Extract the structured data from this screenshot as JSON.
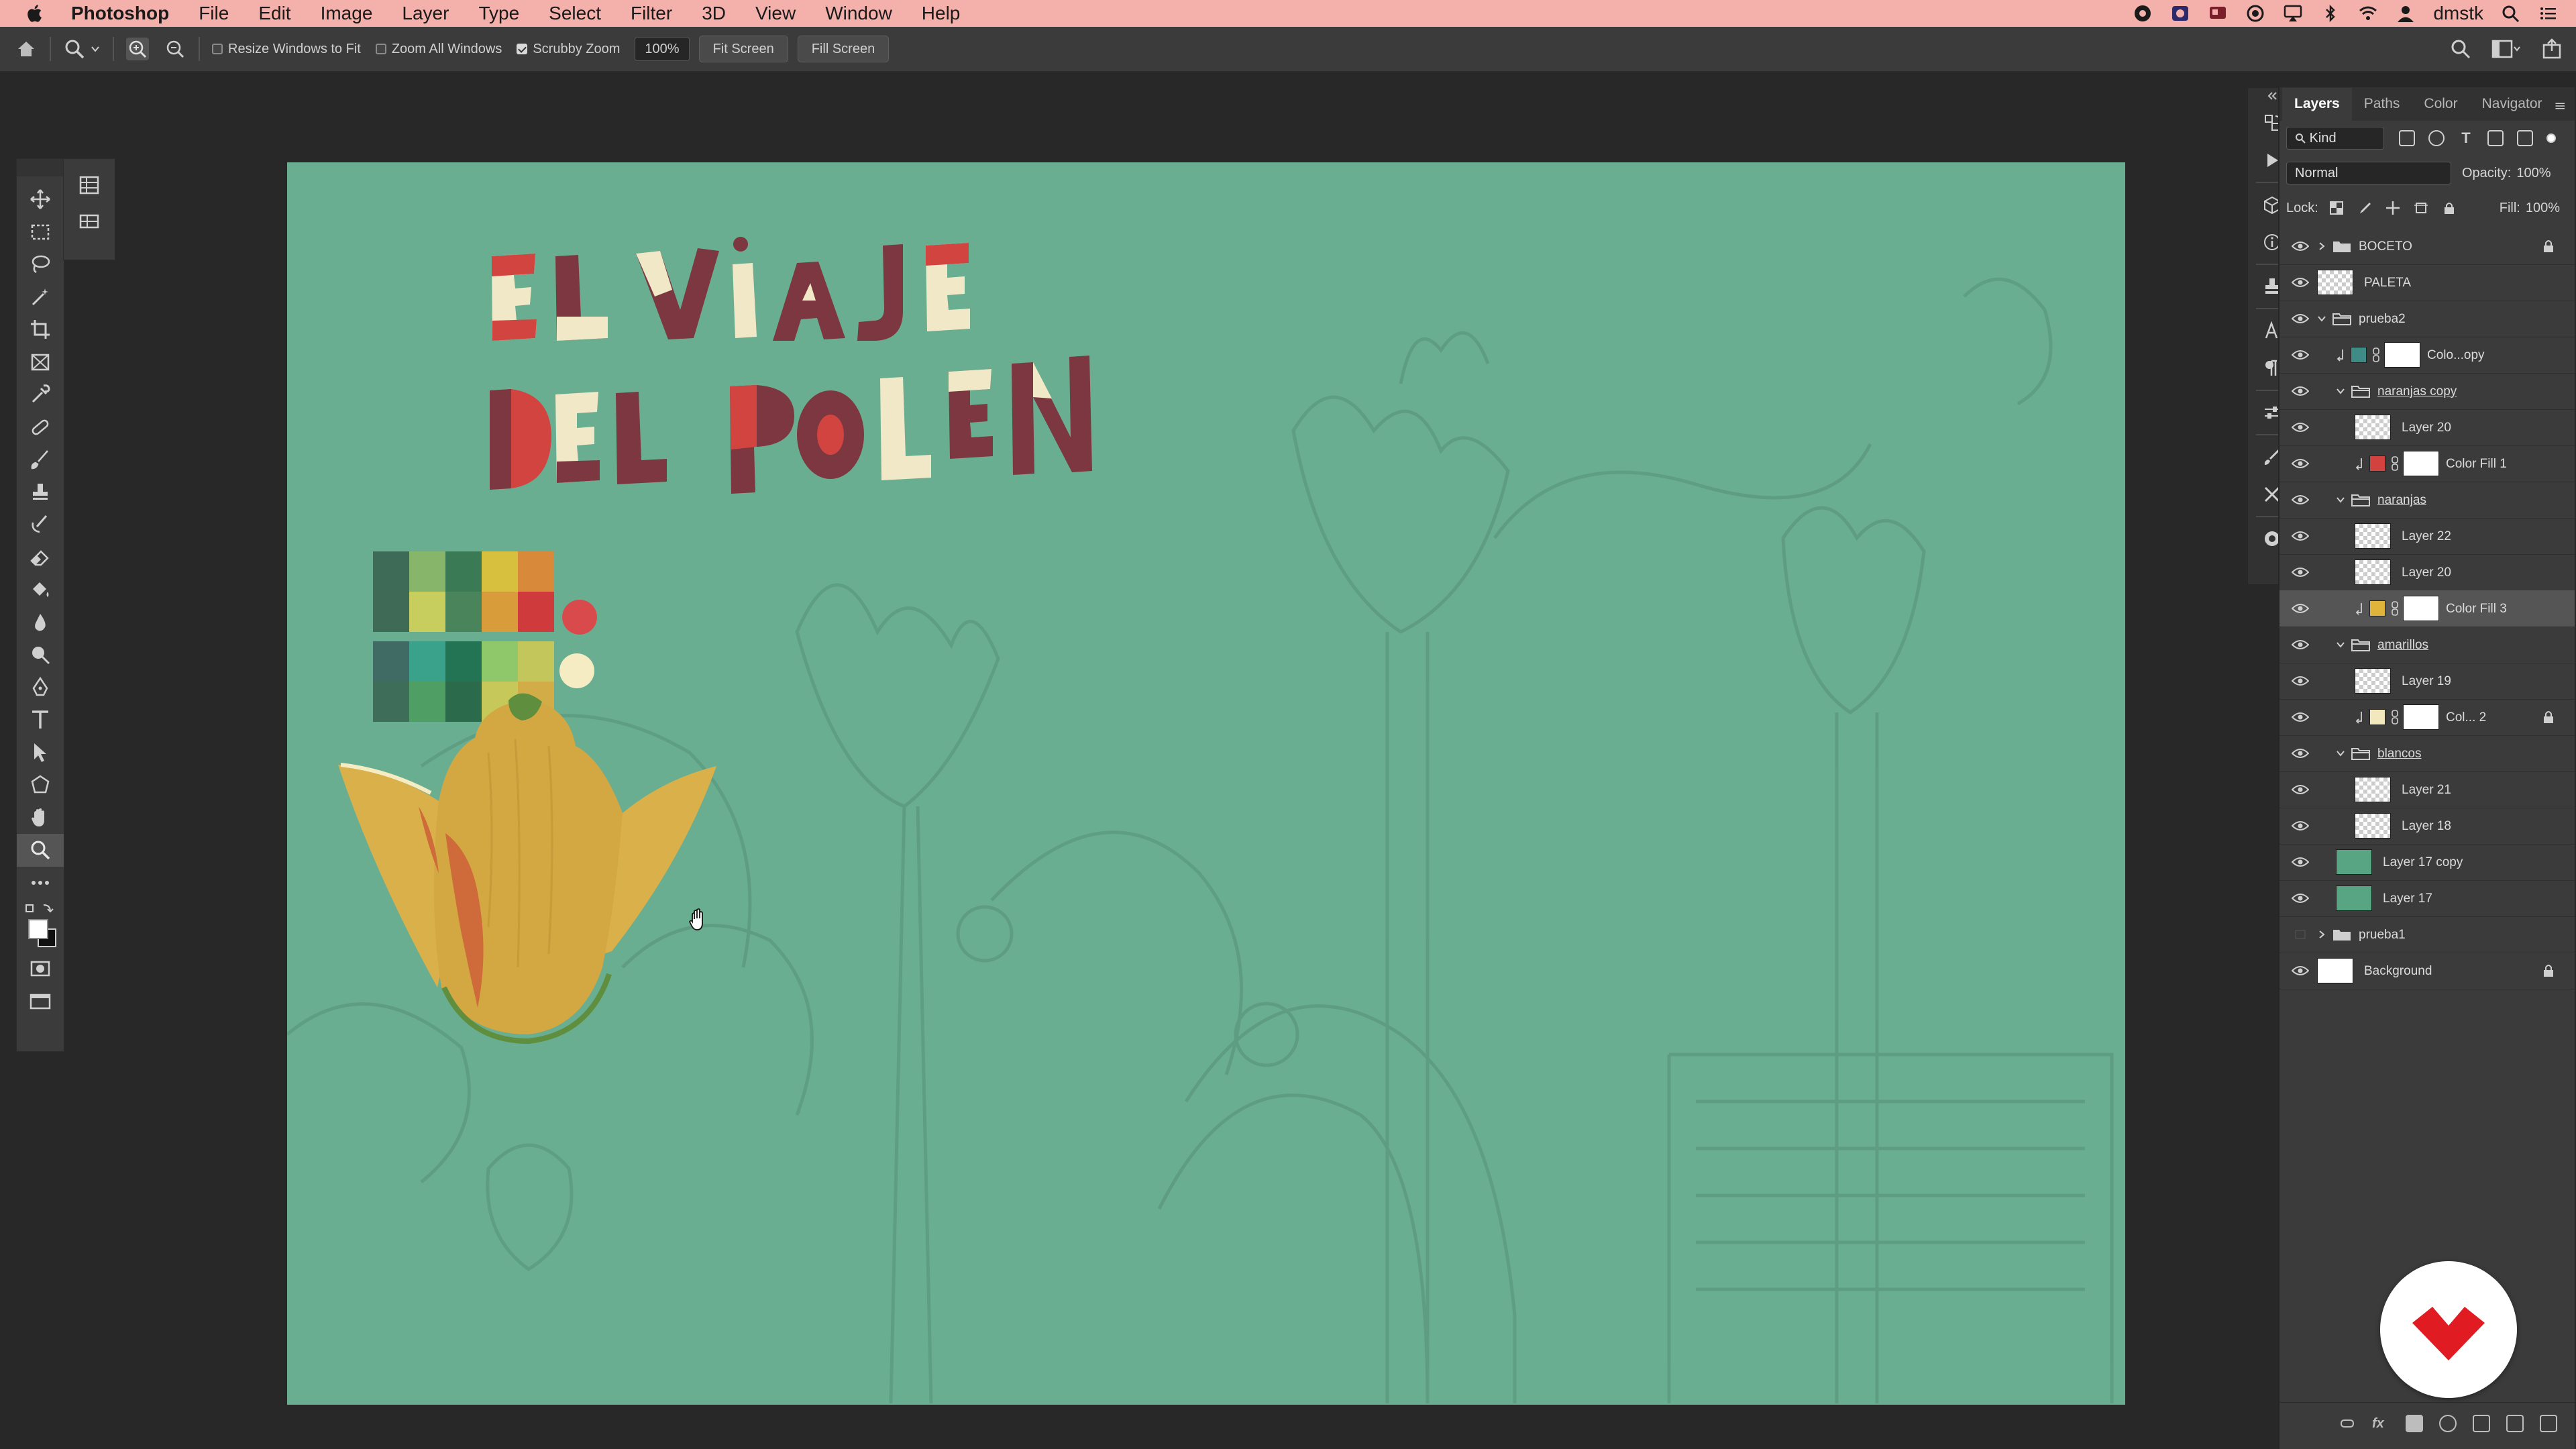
{
  "menubar": {
    "app_name": "Photoshop",
    "items": [
      "File",
      "Edit",
      "Image",
      "Layer",
      "Type",
      "Select",
      "Filter",
      "3D",
      "View",
      "Window",
      "Help"
    ],
    "user": "dmstk"
  },
  "options": {
    "resize_windows": "Resize Windows to Fit",
    "zoom_all": "Zoom All Windows",
    "scrubby_zoom": "Scrubby Zoom",
    "zoom_value": "100%",
    "fit_screen": "Fit Screen",
    "fill_screen": "Fill Screen"
  },
  "panel": {
    "tabs": [
      "Layers",
      "Paths",
      "Color",
      "Navigator"
    ],
    "filter_kind": "Kind",
    "blend_mode": "Normal",
    "opacity_label": "Opacity:",
    "opacity_value": "100%",
    "lock_label": "Lock:",
    "fill_label": "Fill:",
    "fill_value": "100%"
  },
  "layers": [
    {
      "name": "BOCETO",
      "type": "group",
      "indent": 0,
      "expanded": false,
      "visible": true,
      "locked": true
    },
    {
      "name": "PALETA",
      "type": "layer",
      "indent": 0,
      "visible": true,
      "thumb": "checker"
    },
    {
      "name": "prueba2",
      "type": "group",
      "indent": 0,
      "expanded": true,
      "visible": true
    },
    {
      "name": "Colo...opy",
      "type": "fill",
      "indent": 1,
      "visible": true,
      "color": "#3f8c86",
      "clipped": true
    },
    {
      "name": "naranjas copy",
      "type": "group",
      "indent": 1,
      "expanded": true,
      "visible": true,
      "underline": true
    },
    {
      "name": "Layer 20",
      "type": "layer",
      "indent": 2,
      "visible": true,
      "thumb": "checker"
    },
    {
      "name": "Color Fill 1",
      "type": "fill",
      "indent": 2,
      "visible": true,
      "color": "#d2433f",
      "clipped": true
    },
    {
      "name": "naranjas",
      "type": "group",
      "indent": 1,
      "expanded": true,
      "visible": true,
      "underline": true
    },
    {
      "name": "Layer 22",
      "type": "layer",
      "indent": 2,
      "visible": true,
      "thumb": "checker"
    },
    {
      "name": "Layer 20",
      "type": "layer",
      "indent": 2,
      "visible": true,
      "thumb": "checker"
    },
    {
      "name": "Color Fill 3",
      "type": "fill",
      "indent": 2,
      "visible": true,
      "color": "#e0b43a",
      "clipped": true,
      "selected": true
    },
    {
      "name": "amarillos",
      "type": "group",
      "indent": 1,
      "expanded": true,
      "visible": true,
      "underline": true
    },
    {
      "name": "Layer 19",
      "type": "layer",
      "indent": 2,
      "visible": true,
      "thumb": "checker"
    },
    {
      "name": "Col... 2",
      "type": "fill",
      "indent": 2,
      "visible": true,
      "color": "#f3e8bd",
      "clipped": true,
      "locked": true
    },
    {
      "name": "blancos",
      "type": "group",
      "indent": 1,
      "expanded": true,
      "visible": true,
      "underline": true
    },
    {
      "name": "Layer 21",
      "type": "layer",
      "indent": 2,
      "visible": true,
      "thumb": "checker"
    },
    {
      "name": "Layer 18",
      "type": "layer",
      "indent": 2,
      "visible": true,
      "thumb": "checker"
    },
    {
      "name": "Layer 17 copy",
      "type": "layer",
      "indent": 1,
      "visible": true,
      "thumb": "#58a583"
    },
    {
      "name": "Layer 17",
      "type": "layer",
      "indent": 1,
      "visible": true,
      "thumb": "#58a583"
    },
    {
      "name": "prueba1",
      "type": "group",
      "indent": 0,
      "expanded": false,
      "visible": false
    },
    {
      "name": "Background",
      "type": "layer",
      "indent": 0,
      "visible": true,
      "thumb": "#ffffff",
      "locked": true
    }
  ],
  "canvas": {
    "title_line1": "EL ViaJE",
    "title_line2": "DEL POLEN",
    "background_color": "#6aae91",
    "palette_row1": [
      "#3d6b57",
      "#87b66a",
      "#3a7a55",
      "#d8c03f",
      "#d9893a",
      "#3f6a55",
      "#c8ce5e",
      "#49845b",
      "#d89d3a",
      "#cf3a3d"
    ],
    "palette_row2": [
      "#3f6b64",
      "#3aa28a",
      "#227455",
      "#8fc86a",
      "#c3c65a",
      "#3e6d5a",
      "#4f9f64",
      "#2b6b4b",
      "#c6c85a",
      "#d2ad47"
    ],
    "dot_red": "#d94a4c",
    "dot_cream": "#f5ecc3"
  },
  "colors": {
    "menubar_bg": "#f4b1ac",
    "title_red": "#d24440",
    "title_maroon": "#7c3741",
    "title_cream": "#f1e8c8",
    "flower_yellow": "#d9b04a",
    "flower_orange": "#cf6a3a"
  }
}
